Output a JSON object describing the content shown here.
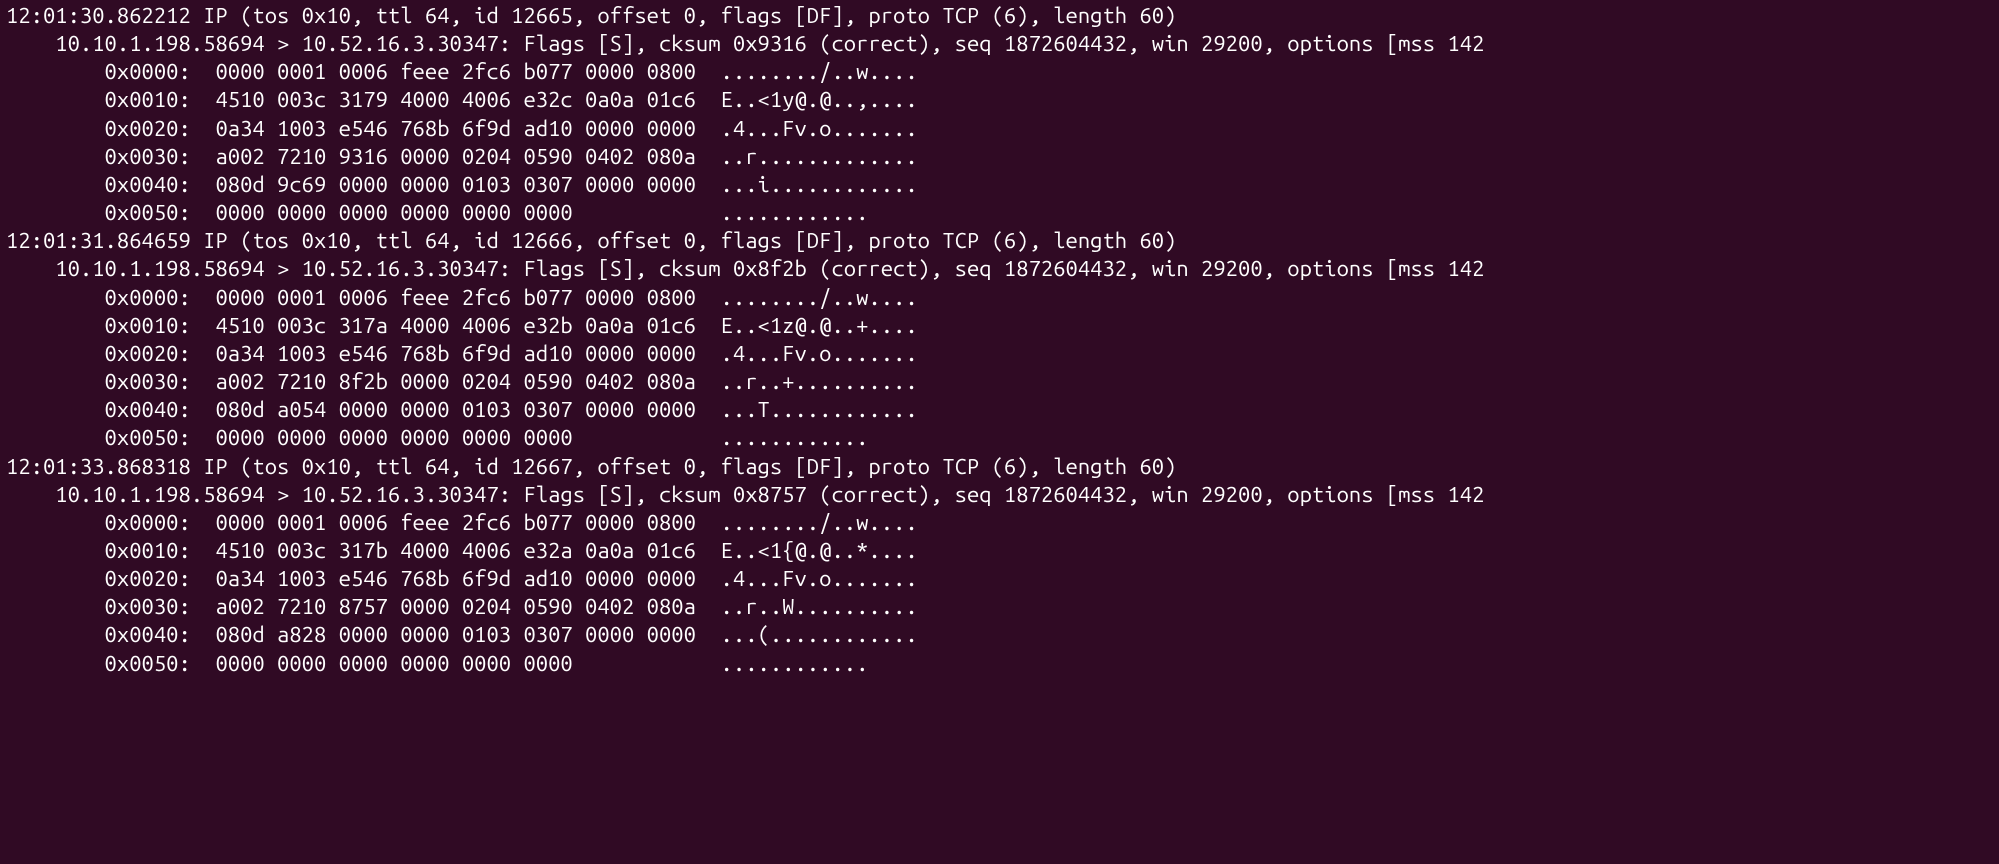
{
  "packets": [
    {
      "header": "12:01:30.862212 IP (tos 0x10, ttl 64, id 12665, offset 0, flags [DF], proto TCP (6), length 60)",
      "flow": "    10.10.1.198.58694 > 10.52.16.3.30347: Flags [S], cksum 0x9316 (correct), seq 1872604432, win 29200, options [mss 142",
      "hex": [
        "        0x0000:  0000 0001 0006 feee 2fc6 b077 0000 0800  ......../..w....",
        "        0x0010:  4510 003c 3179 4000 4006 e32c 0a0a 01c6  E..<1y@.@..,....",
        "        0x0020:  0a34 1003 e546 768b 6f9d ad10 0000 0000  .4...Fv.o.......",
        "        0x0030:  a002 7210 9316 0000 0204 0590 0402 080a  ..r.............",
        "        0x0040:  080d 9c69 0000 0000 0103 0307 0000 0000  ...i............",
        "        0x0050:  0000 0000 0000 0000 0000 0000            ............"
      ]
    },
    {
      "header": "12:01:31.864659 IP (tos 0x10, ttl 64, id 12666, offset 0, flags [DF], proto TCP (6), length 60)",
      "flow": "    10.10.1.198.58694 > 10.52.16.3.30347: Flags [S], cksum 0x8f2b (correct), seq 1872604432, win 29200, options [mss 142",
      "hex": [
        "        0x0000:  0000 0001 0006 feee 2fc6 b077 0000 0800  ......../..w....",
        "        0x0010:  4510 003c 317a 4000 4006 e32b 0a0a 01c6  E..<1z@.@..+....",
        "        0x0020:  0a34 1003 e546 768b 6f9d ad10 0000 0000  .4...Fv.o.......",
        "        0x0030:  a002 7210 8f2b 0000 0204 0590 0402 080a  ..r..+..........",
        "        0x0040:  080d a054 0000 0000 0103 0307 0000 0000  ...T............",
        "        0x0050:  0000 0000 0000 0000 0000 0000            ............"
      ]
    },
    {
      "header": "12:01:33.868318 IP (tos 0x10, ttl 64, id 12667, offset 0, flags [DF], proto TCP (6), length 60)",
      "flow": "    10.10.1.198.58694 > 10.52.16.3.30347: Flags [S], cksum 0x8757 (correct), seq 1872604432, win 29200, options [mss 142",
      "hex": [
        "        0x0000:  0000 0001 0006 feee 2fc6 b077 0000 0800  ......../..w....",
        "        0x0010:  4510 003c 317b 4000 4006 e32a 0a0a 01c6  E..<1{@.@..*....",
        "        0x0020:  0a34 1003 e546 768b 6f9d ad10 0000 0000  .4...Fv.o.......",
        "        0x0030:  a002 7210 8757 0000 0204 0590 0402 080a  ..r..W..........",
        "        0x0040:  080d a828 0000 0000 0103 0307 0000 0000  ...(............",
        "        0x0050:  0000 0000 0000 0000 0000 0000            ............"
      ]
    }
  ]
}
